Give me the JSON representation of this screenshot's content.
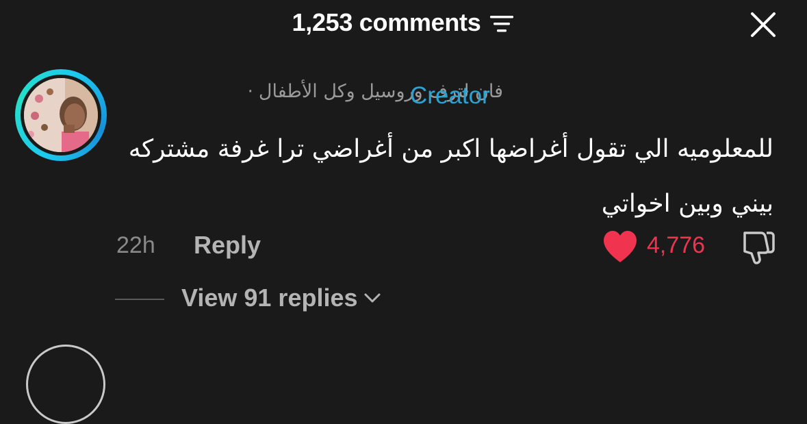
{
  "header": {
    "title": "1,253 comments",
    "sort_icon": "sort-lines-icon",
    "close_icon": "close-icon"
  },
  "comment": {
    "author": "فان لترف وروسيل وكل الأطفال",
    "separator": "·",
    "badge": "Creator",
    "text": "للمعلوميه الي تقول أغراضها اكبر من أغراضي ترا غرفة مشتركه بيني وبين اخواتي",
    "time": "22h",
    "reply_label": "Reply",
    "like_count": "4,776",
    "like_icon": "heart-icon",
    "dislike_icon": "thumbs-down-icon",
    "view_replies_label": "View 91 replies"
  },
  "colors": {
    "background": "#1a1a1a",
    "creator_badge": "#2aa3d4",
    "like": "#f0344f",
    "avatar_ring": "#1ec8f0"
  }
}
